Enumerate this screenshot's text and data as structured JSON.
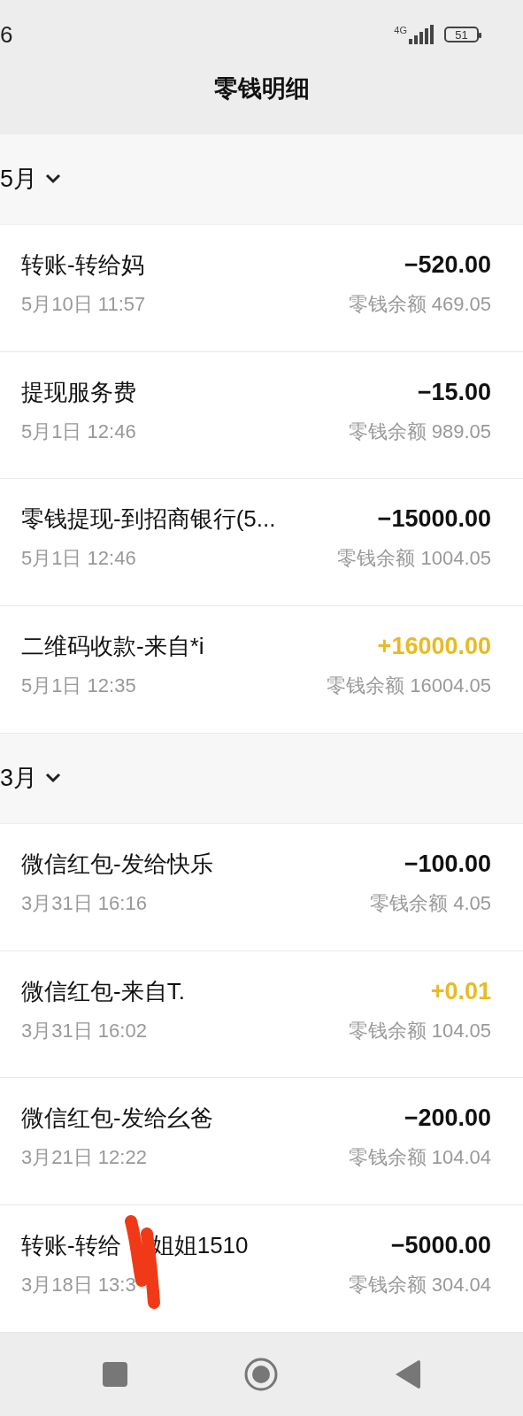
{
  "status_bar": {
    "time": "6",
    "network": "4G",
    "battery": "51"
  },
  "header": {
    "title": "零钱明细"
  },
  "groups": [
    {
      "month": "5月",
      "expanded": true,
      "rows": [
        {
          "title": "转账-转给妈",
          "date": "5月10日 11:57",
          "kind": "out",
          "amount": "−520.00",
          "balance": "零钱余额 469.05"
        },
        {
          "title": "提现服务费",
          "date": "5月1日 12:46",
          "kind": "out",
          "amount": "−15.00",
          "balance": "零钱余额 989.05"
        },
        {
          "title": "零钱提现-到招商银行(5...",
          "date": "5月1日 12:46",
          "kind": "out",
          "amount": "−15000.00",
          "balance": "零钱余额 1004.05"
        },
        {
          "title": "二维码收款-来自*i",
          "date": "5月1日 12:35",
          "kind": "in",
          "amount": "+16000.00",
          "balance": "零钱余额 16004.05"
        }
      ]
    },
    {
      "month": "3月",
      "expanded": true,
      "rows": [
        {
          "title": "微信红包-发给快乐",
          "date": "3月31日 16:16",
          "kind": "out",
          "amount": "−100.00",
          "balance": "零钱余额 4.05"
        },
        {
          "title": "微信红包-来自T.",
          "date": "3月31日 16:02",
          "kind": "in",
          "amount": "+0.01",
          "balance": "零钱余额 104.05"
        },
        {
          "title": "微信红包-发给幺爸",
          "date": "3月21日 12:22",
          "kind": "out",
          "amount": "−200.00",
          "balance": "零钱余额 104.04"
        },
        {
          "title": "转账-转给",
          "title_2": "姐姐1510",
          "scribble": true,
          "date": "3月18日 13:3",
          "kind": "out",
          "amount": "−5000.00",
          "balance": "零钱余额 304.04"
        }
      ]
    }
  ]
}
